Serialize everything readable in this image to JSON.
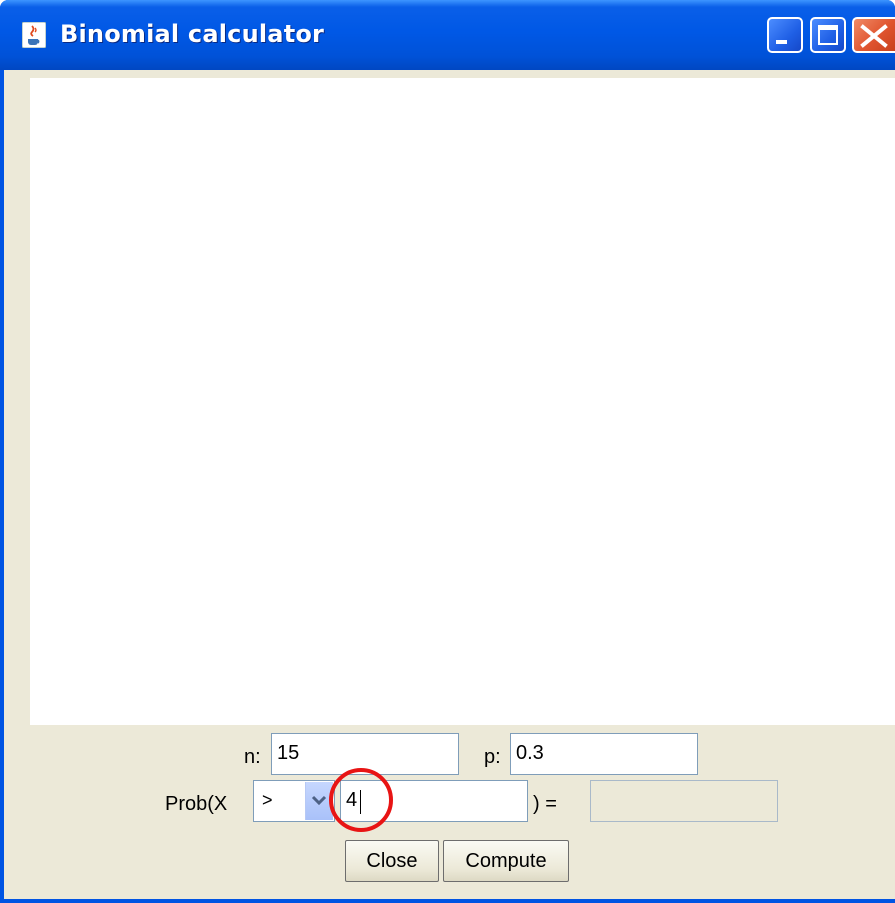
{
  "window": {
    "title": "Binomial calculator"
  },
  "form": {
    "n_label": "n:",
    "n_value": "15",
    "p_label": "p:",
    "p_value": "0.3",
    "prob_prefix": "Prob(X",
    "relation_selected": ">",
    "x_value": "4",
    "prob_suffix": ") =",
    "result_value": ""
  },
  "buttons": {
    "close": "Close",
    "compute": "Compute"
  },
  "colors": {
    "titlebar": "#0058e6",
    "panel": "#ece9d8",
    "highlight": "#e81414"
  }
}
